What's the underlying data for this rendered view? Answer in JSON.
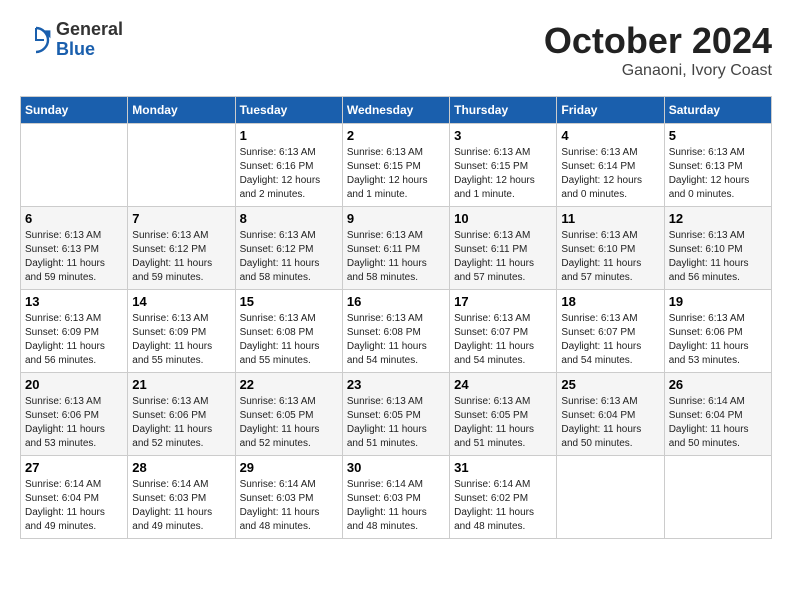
{
  "header": {
    "logo_general": "General",
    "logo_blue": "Blue",
    "month_title": "October 2024",
    "location": "Ganaoni, Ivory Coast"
  },
  "weekdays": [
    "Sunday",
    "Monday",
    "Tuesday",
    "Wednesday",
    "Thursday",
    "Friday",
    "Saturday"
  ],
  "weeks": [
    [
      {
        "day": "",
        "info": ""
      },
      {
        "day": "",
        "info": ""
      },
      {
        "day": "1",
        "info": "Sunrise: 6:13 AM\nSunset: 6:16 PM\nDaylight: 12 hours\nand 2 minutes."
      },
      {
        "day": "2",
        "info": "Sunrise: 6:13 AM\nSunset: 6:15 PM\nDaylight: 12 hours\nand 1 minute."
      },
      {
        "day": "3",
        "info": "Sunrise: 6:13 AM\nSunset: 6:15 PM\nDaylight: 12 hours\nand 1 minute."
      },
      {
        "day": "4",
        "info": "Sunrise: 6:13 AM\nSunset: 6:14 PM\nDaylight: 12 hours\nand 0 minutes."
      },
      {
        "day": "5",
        "info": "Sunrise: 6:13 AM\nSunset: 6:13 PM\nDaylight: 12 hours\nand 0 minutes."
      }
    ],
    [
      {
        "day": "6",
        "info": "Sunrise: 6:13 AM\nSunset: 6:13 PM\nDaylight: 11 hours\nand 59 minutes."
      },
      {
        "day": "7",
        "info": "Sunrise: 6:13 AM\nSunset: 6:12 PM\nDaylight: 11 hours\nand 59 minutes."
      },
      {
        "day": "8",
        "info": "Sunrise: 6:13 AM\nSunset: 6:12 PM\nDaylight: 11 hours\nand 58 minutes."
      },
      {
        "day": "9",
        "info": "Sunrise: 6:13 AM\nSunset: 6:11 PM\nDaylight: 11 hours\nand 58 minutes."
      },
      {
        "day": "10",
        "info": "Sunrise: 6:13 AM\nSunset: 6:11 PM\nDaylight: 11 hours\nand 57 minutes."
      },
      {
        "day": "11",
        "info": "Sunrise: 6:13 AM\nSunset: 6:10 PM\nDaylight: 11 hours\nand 57 minutes."
      },
      {
        "day": "12",
        "info": "Sunrise: 6:13 AM\nSunset: 6:10 PM\nDaylight: 11 hours\nand 56 minutes."
      }
    ],
    [
      {
        "day": "13",
        "info": "Sunrise: 6:13 AM\nSunset: 6:09 PM\nDaylight: 11 hours\nand 56 minutes."
      },
      {
        "day": "14",
        "info": "Sunrise: 6:13 AM\nSunset: 6:09 PM\nDaylight: 11 hours\nand 55 minutes."
      },
      {
        "day": "15",
        "info": "Sunrise: 6:13 AM\nSunset: 6:08 PM\nDaylight: 11 hours\nand 55 minutes."
      },
      {
        "day": "16",
        "info": "Sunrise: 6:13 AM\nSunset: 6:08 PM\nDaylight: 11 hours\nand 54 minutes."
      },
      {
        "day": "17",
        "info": "Sunrise: 6:13 AM\nSunset: 6:07 PM\nDaylight: 11 hours\nand 54 minutes."
      },
      {
        "day": "18",
        "info": "Sunrise: 6:13 AM\nSunset: 6:07 PM\nDaylight: 11 hours\nand 54 minutes."
      },
      {
        "day": "19",
        "info": "Sunrise: 6:13 AM\nSunset: 6:06 PM\nDaylight: 11 hours\nand 53 minutes."
      }
    ],
    [
      {
        "day": "20",
        "info": "Sunrise: 6:13 AM\nSunset: 6:06 PM\nDaylight: 11 hours\nand 53 minutes."
      },
      {
        "day": "21",
        "info": "Sunrise: 6:13 AM\nSunset: 6:06 PM\nDaylight: 11 hours\nand 52 minutes."
      },
      {
        "day": "22",
        "info": "Sunrise: 6:13 AM\nSunset: 6:05 PM\nDaylight: 11 hours\nand 52 minutes."
      },
      {
        "day": "23",
        "info": "Sunrise: 6:13 AM\nSunset: 6:05 PM\nDaylight: 11 hours\nand 51 minutes."
      },
      {
        "day": "24",
        "info": "Sunrise: 6:13 AM\nSunset: 6:05 PM\nDaylight: 11 hours\nand 51 minutes."
      },
      {
        "day": "25",
        "info": "Sunrise: 6:13 AM\nSunset: 6:04 PM\nDaylight: 11 hours\nand 50 minutes."
      },
      {
        "day": "26",
        "info": "Sunrise: 6:14 AM\nSunset: 6:04 PM\nDaylight: 11 hours\nand 50 minutes."
      }
    ],
    [
      {
        "day": "27",
        "info": "Sunrise: 6:14 AM\nSunset: 6:04 PM\nDaylight: 11 hours\nand 49 minutes."
      },
      {
        "day": "28",
        "info": "Sunrise: 6:14 AM\nSunset: 6:03 PM\nDaylight: 11 hours\nand 49 minutes."
      },
      {
        "day": "29",
        "info": "Sunrise: 6:14 AM\nSunset: 6:03 PM\nDaylight: 11 hours\nand 48 minutes."
      },
      {
        "day": "30",
        "info": "Sunrise: 6:14 AM\nSunset: 6:03 PM\nDaylight: 11 hours\nand 48 minutes."
      },
      {
        "day": "31",
        "info": "Sunrise: 6:14 AM\nSunset: 6:02 PM\nDaylight: 11 hours\nand 48 minutes."
      },
      {
        "day": "",
        "info": ""
      },
      {
        "day": "",
        "info": ""
      }
    ]
  ]
}
